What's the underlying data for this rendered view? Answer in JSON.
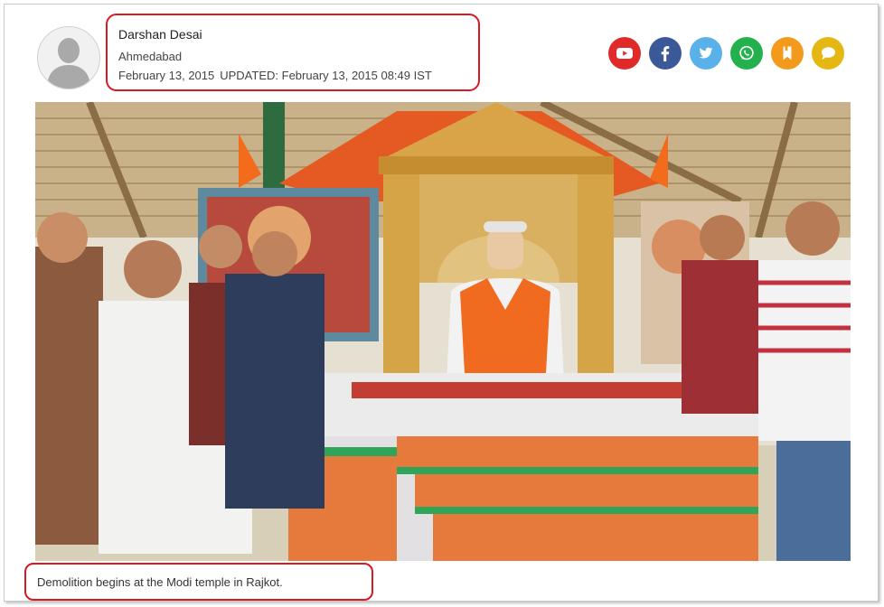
{
  "author": {
    "name": "Darshan Desai",
    "location": "Ahmedabad",
    "published": "February 13, 2015",
    "updated_label": "UPDATED:",
    "updated": "February 13, 2015 08:49 IST",
    "avatar_icon": "user-silhouette-icon"
  },
  "share": {
    "buttons": [
      {
        "icon": "youtube-icon",
        "color": "#e02a2a"
      },
      {
        "icon": "facebook-icon",
        "color": "#3b5998"
      },
      {
        "icon": "twitter-icon",
        "color": "#5ab1e9"
      },
      {
        "icon": "whatsapp-icon",
        "color": "#22b14c"
      },
      {
        "icon": "bookmark-icon",
        "color": "#f39a1d"
      },
      {
        "icon": "comment-icon",
        "color": "#e4b712"
      }
    ]
  },
  "photo": {
    "caption": "Demolition begins at the Modi temple in Rajkot."
  },
  "colors": {
    "highlight": "#d71921",
    "text": "#333333"
  }
}
